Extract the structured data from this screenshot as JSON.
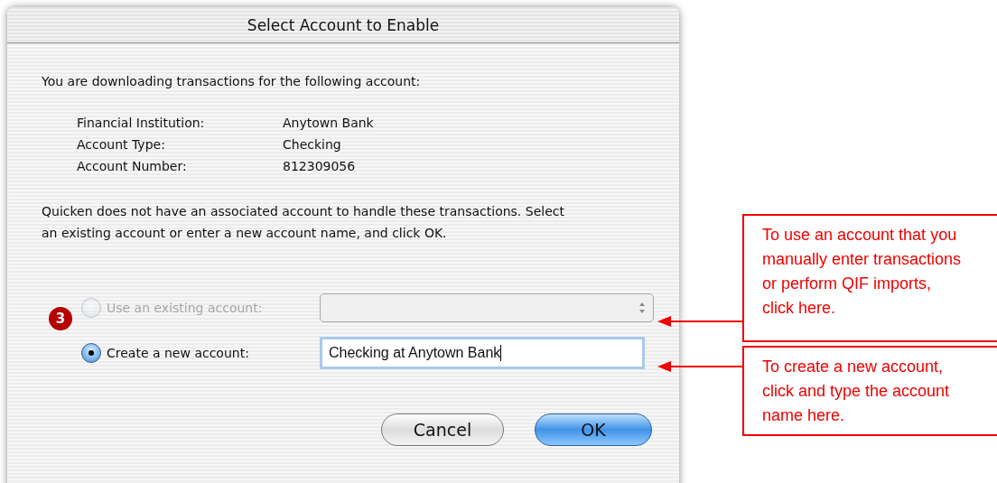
{
  "window": {
    "title": "Select Account to Enable"
  },
  "intro": "You are downloading transactions for the following account:",
  "details": [
    {
      "label": "Financial Institution:",
      "value": "Anytown Bank"
    },
    {
      "label": "Account Type:",
      "value": "Checking"
    },
    {
      "label": "Account Number:",
      "value": "812309056"
    }
  ],
  "message": "Quicken does not have an associated account to handle these transactions. Select an existing account or enter a new account name, and click OK.",
  "step_badge": "3",
  "options": [
    {
      "kind": "dropdown",
      "label": "Use an existing account:",
      "selected": false,
      "disabled": true
    },
    {
      "kind": "text",
      "label": "Create a new account:",
      "selected": true,
      "disabled": false,
      "value": "Checking at Anytown Bank"
    }
  ],
  "buttons": [
    {
      "label": "Cancel",
      "default": false
    },
    {
      "label": "OK",
      "default": true
    }
  ],
  "callouts": [
    "To use an account that you manually enter transactions or perform QIF imports, click here.",
    "To create a new account, click and type the account name here."
  ]
}
